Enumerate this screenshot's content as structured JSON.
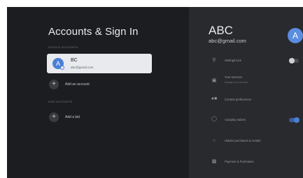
{
  "accounts_panel": {
    "title": "Accounts & Sign In",
    "google_accounts_label": "GOOGLE ACCOUNTS",
    "account": {
      "avatar_letter": "A",
      "name": "BC",
      "email": "abc@gmail.com"
    },
    "add_account_label": "Add an account",
    "kids_accounts_label": "KIDS ACCOUNTS",
    "add_kid_label": "Add a kid"
  },
  "profile_panel": {
    "name": "ABC",
    "email": "abc@gmail.com",
    "avatar_letter": "A",
    "settings": [
      {
        "icon": "lock-icon",
        "label": "Settings lock",
        "toggle": "off"
      },
      {
        "icon": "services-icon",
        "label": "Your services",
        "sublabel": "Manage your services"
      },
      {
        "icon": "content-preferences-icon",
        "label": "Content preferences"
      },
      {
        "icon": "autoplay-icon",
        "label": "Autoplay trailers",
        "toggle": "on"
      },
      {
        "icon": "hidden-purchases-icon",
        "label": "Hidden purchases & rentals"
      },
      {
        "icon": "payment-icon",
        "label": "Payment & Purchases"
      }
    ]
  },
  "colors": {
    "accent": "#4a7fd6",
    "background": "#202124",
    "card": "#e8eaed"
  }
}
